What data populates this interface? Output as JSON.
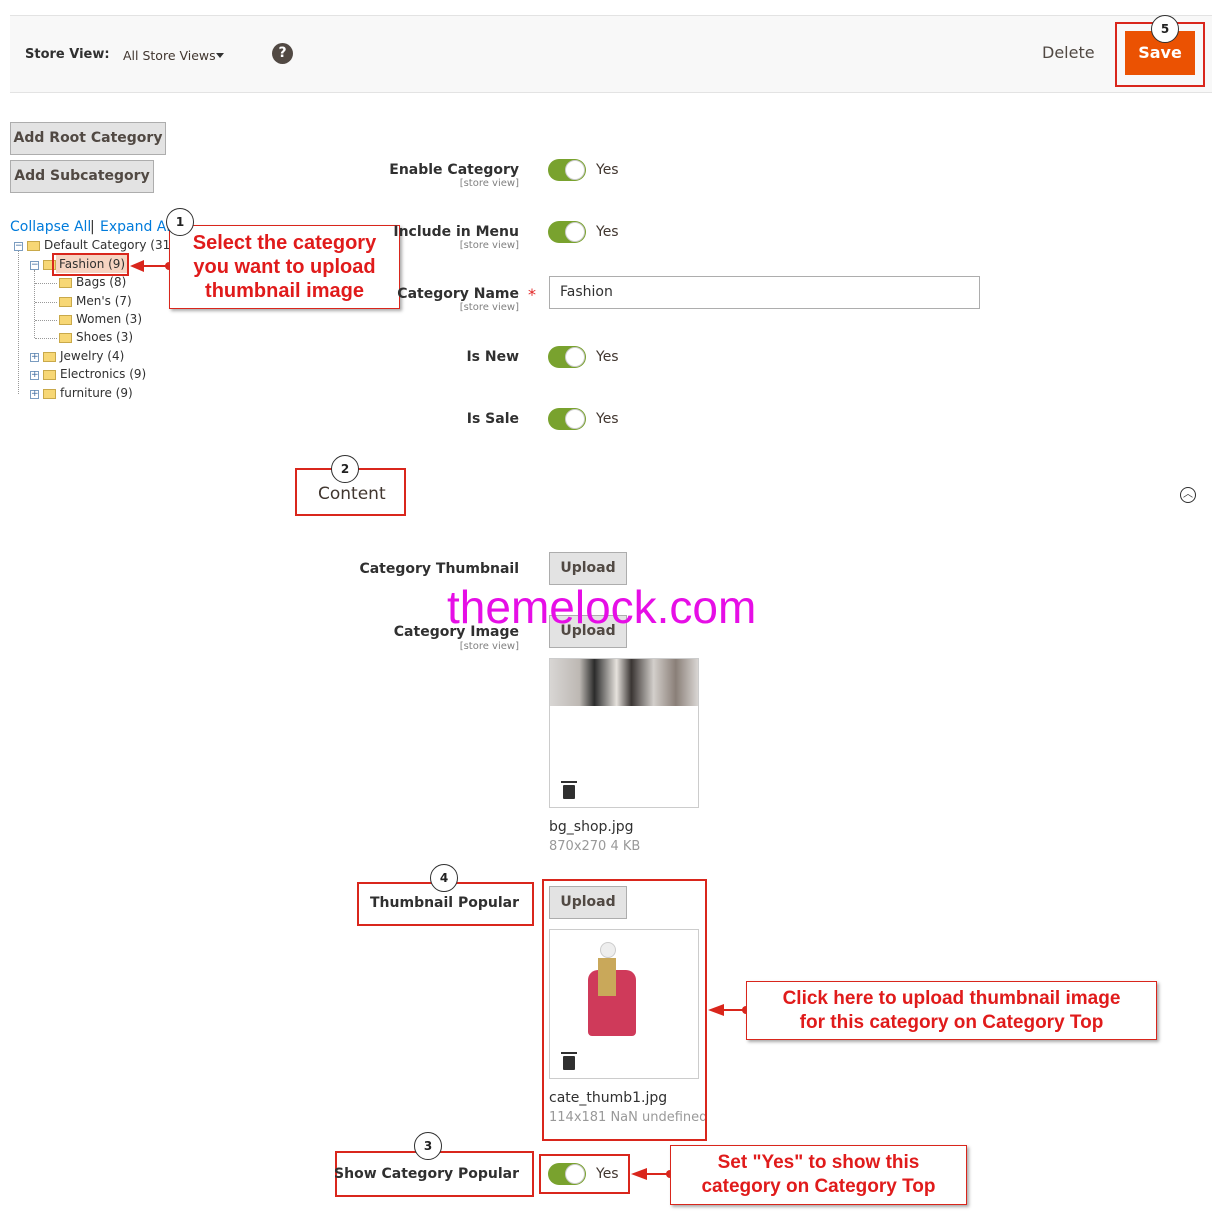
{
  "toolbar": {
    "store_view_label": "Store View:",
    "store_view_value": "All Store Views",
    "help_symbol": "?",
    "delete_label": "Delete",
    "save_label": "Save"
  },
  "left_panel": {
    "add_root": "Add Root Category",
    "add_sub": "Add Subcategory",
    "collapse_all": "Collapse All",
    "separator": "|",
    "expand_all": "Expand All",
    "tree": [
      {
        "label": "Default Category (31)"
      },
      {
        "label": "Fashion (9)"
      },
      {
        "label": "Bags (8)"
      },
      {
        "label": "Men's (7)"
      },
      {
        "label": "Women (3)"
      },
      {
        "label": "Shoes (3)"
      },
      {
        "label": "Jewelry (4)"
      },
      {
        "label": "Electronics (9)"
      },
      {
        "label": "furniture (9)"
      }
    ]
  },
  "form": {
    "scope_text": "[store view]",
    "yes": "Yes",
    "enable_category": "Enable Category",
    "include_in_menu": "Include in Menu",
    "category_name": "Category Name",
    "category_name_value": "Fashion",
    "is_new": "Is New",
    "is_sale": "Is Sale",
    "content_title": "Content",
    "category_thumbnail": "Category Thumbnail",
    "category_image": "Category Image",
    "upload": "Upload",
    "image_file": "bg_shop.jpg",
    "image_meta": "870x270 4 KB",
    "thumbnail_popular": "Thumbnail Popular",
    "thumb_file": "cate_thumb1.jpg",
    "thumb_meta": "114x181 NaN undefined",
    "show_category_popular": "Show Category Popular"
  },
  "annotations": {
    "step1": "1",
    "step2": "2",
    "step3": "3",
    "step4": "4",
    "step5": "5",
    "callout1_line1": "Select the category",
    "callout1_line2": "you want to upload",
    "callout1_line3": "thumbnail image",
    "callout4_line1": "Click here to upload thumbnail image",
    "callout4_line2": "for this category on Category Top",
    "callout3_line1": "Set \"Yes\" to show this",
    "callout3_line2": "category on Category Top",
    "accent_color": "#d9261c"
  },
  "watermark": "themelock.com"
}
